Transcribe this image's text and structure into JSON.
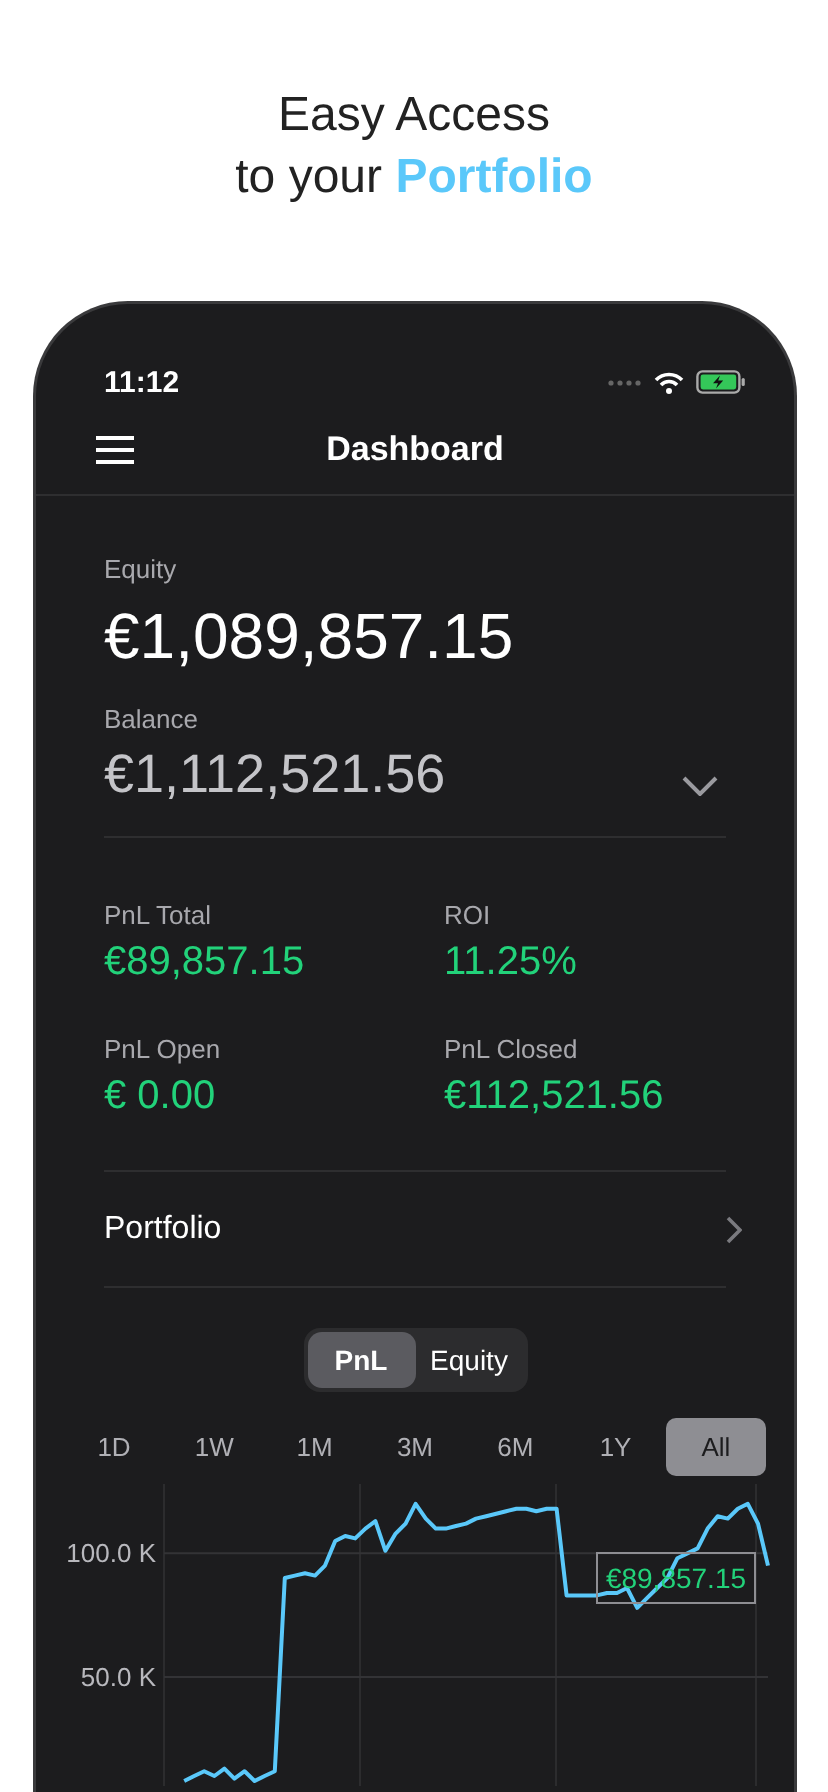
{
  "heading": {
    "line_1": "Easy Access",
    "line_2": "to your",
    "highlight": "Portfolio"
  },
  "status_bar": {
    "time": "11:12"
  },
  "nav": {
    "title": "Dashboard"
  },
  "summary": {
    "equity_label": "Equity",
    "equity": "€1,089,857.15",
    "balance_label": "Balance",
    "balance": "€1,112,521.56"
  },
  "stats": [
    {
      "label": "PnL Total",
      "value": "€89,857.15"
    },
    {
      "label": "ROI",
      "value": "11.25%"
    },
    {
      "label": "PnL Open",
      "value": "€ 0.00"
    },
    {
      "label": "PnL Closed",
      "value": "€112,521.56"
    }
  ],
  "portfolio": {
    "label": "Portfolio"
  },
  "chart_modes": [
    {
      "label": "PnL",
      "selected": true
    },
    {
      "label": "Equity",
      "selected": false
    }
  ],
  "ranges": [
    {
      "label": "1D",
      "selected": false
    },
    {
      "label": "1W",
      "selected": false
    },
    {
      "label": "1M",
      "selected": false
    },
    {
      "label": "3M",
      "selected": false
    },
    {
      "label": "6M",
      "selected": false
    },
    {
      "label": "1Y",
      "selected": false
    },
    {
      "label": "All",
      "selected": true
    }
  ],
  "chart": {
    "tooltip": "€89,857.15",
    "chart_data": {
      "type": "line",
      "ylim": [
        6,
        128
      ],
      "grid": true,
      "yticks": [
        {
          "value": 50,
          "label": "50.0 K"
        },
        {
          "value": 100,
          "label": "100.0 K"
        }
      ],
      "series": [
        {
          "color": "#5ac8fa",
          "values": [
            null,
            null,
            8,
            10,
            12,
            10,
            13,
            9,
            12,
            8,
            10,
            12,
            90,
            91,
            92,
            91,
            95,
            105,
            107,
            106,
            110,
            113,
            101,
            108,
            112,
            120,
            114,
            110,
            110,
            111,
            112,
            114,
            115,
            116,
            117,
            118,
            118,
            117,
            118,
            118,
            83,
            83,
            83,
            83,
            84,
            84,
            86,
            78,
            82,
            86,
            90,
            98,
            100,
            102,
            110,
            115,
            114,
            118,
            120,
            112,
            95
          ]
        }
      ]
    }
  }
}
